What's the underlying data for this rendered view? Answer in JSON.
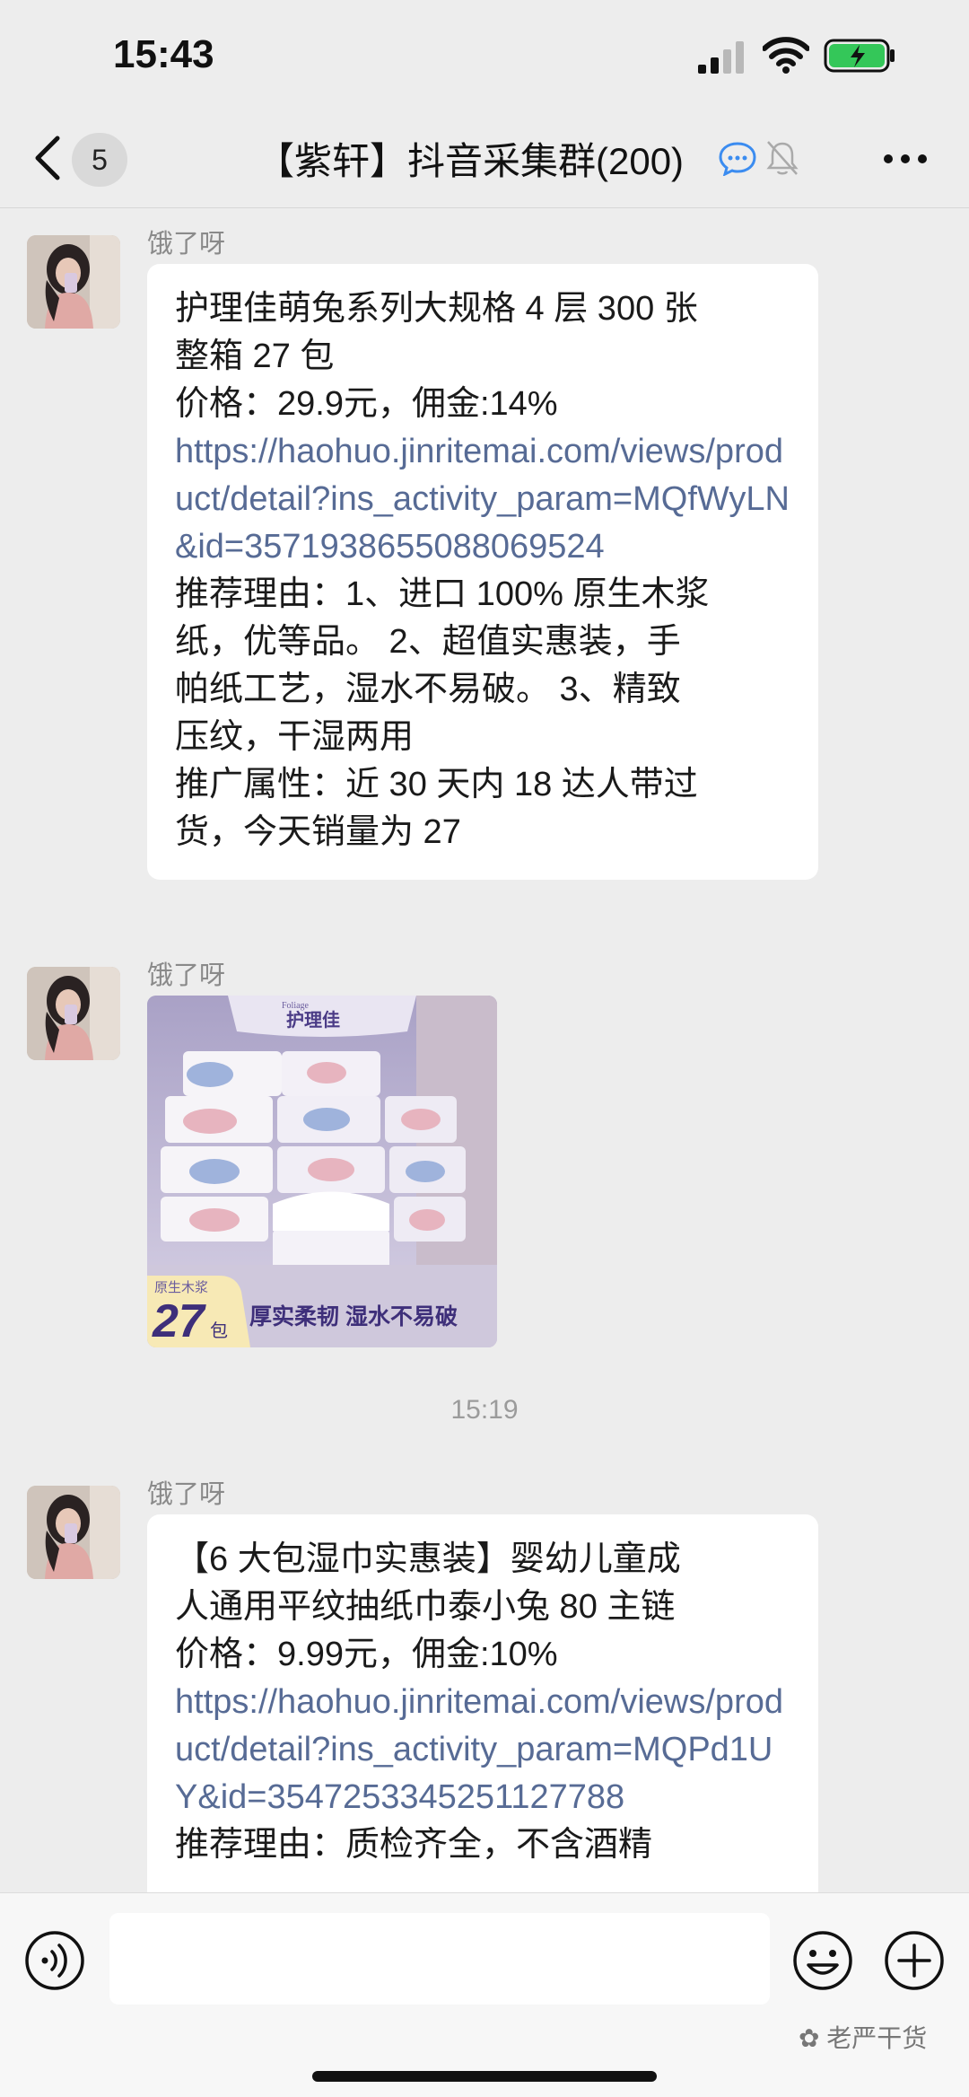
{
  "status_bar": {
    "time": "15:43"
  },
  "nav": {
    "back_count": "5",
    "title": "【紫轩】抖音采集群(200)"
  },
  "messages": [
    {
      "sender": "饿了呀",
      "lines": [
        "护理佳萌兔系列大规格 4 层 300 张",
        "整箱 27 包",
        "价格：29.9元，佣金:14%"
      ],
      "link": "https://haohuo.jinritemai.com/views/product/detail?ins_activity_param=MQfWyLN&id=3571938655088069524",
      "reason_lines": [
        "推荐理由：1、进口 100% 原生木浆",
        "纸，优等品。 2、超值实惠装，手",
        "帕纸工艺，湿水不易破。 3、精致",
        "压纹，干湿两用",
        "推广属性：近 30 天内 18 达人带过",
        "货，今天销量为 27"
      ]
    },
    {
      "sender": "饿了呀",
      "image": {
        "brand_small": "Foliage",
        "brand": "护理佳",
        "badge_top": "原生木浆",
        "badge_count": "27",
        "badge_unit": "包",
        "slogan": "厚实柔韧 湿水不易破"
      }
    },
    {
      "sender": "饿了呀",
      "lines": [
        "【6 大包湿巾实惠装】婴幼儿童成",
        "人通用平纹抽纸巾泰小兔 80 主链",
        "价格：9.99元，佣金:10%"
      ],
      "link": "https://haohuo.jinritemai.com/views/product/detail?ins_activity_param=MQPd1UY&id=3547253345251127788",
      "reason_lines": [
        "推荐理由：质检齐全，不含酒精"
      ]
    }
  ],
  "timestamp": "15:19",
  "watermark": "老严干货",
  "icons": {
    "back": "chevron-left-icon",
    "chat": "chat-bubble-icon",
    "mute": "bell-off-icon",
    "more": "more-icon",
    "voice": "voice-icon",
    "emoji": "emoji-icon",
    "plus": "plus-icon"
  },
  "colors": {
    "link": "#576b95",
    "background": "#ededed",
    "bubble": "#ffffff"
  }
}
